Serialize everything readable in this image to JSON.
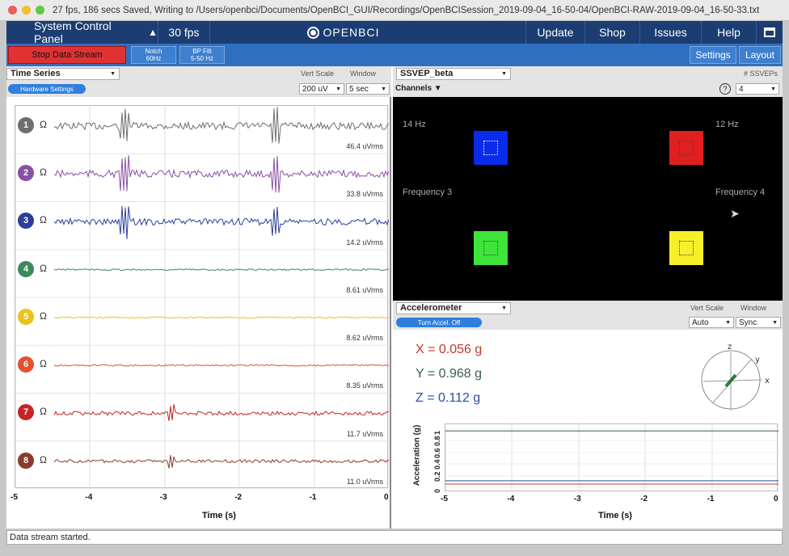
{
  "window": {
    "title": "27 fps, 186 secs Saved, Writing to /Users/openbci/Documents/OpenBCI_GUI/Recordings/OpenBCISession_2019-09-04_16-50-04/OpenBCI-RAW-2019-09-04_16-50-33.txt"
  },
  "nav": {
    "system_control_panel": "System Control Panel",
    "caret": "▲",
    "fps": "30 fps",
    "logo": "OPENBCI",
    "update": "Update",
    "shop": "Shop",
    "issues": "Issues",
    "help": "Help"
  },
  "controls": {
    "stop_stream": "Stop Data Stream",
    "notch_line1": "Notch",
    "notch_line2": "60Hz",
    "bp_line1": "BP Filt",
    "bp_line2": "5-50 Hz",
    "settings": "Settings",
    "layout": "Layout"
  },
  "time_series": {
    "widget": "Time Series",
    "hardware_settings": "Hardware Settings",
    "vert_scale_label": "Vert Scale",
    "window_label": "Window",
    "vert_scale_value": "200 uV",
    "window_value": "5 sec",
    "channels": [
      {
        "num": "1",
        "color": "#6e6e6e",
        "rms": "46.4 uVrms"
      },
      {
        "num": "2",
        "color": "#8a4fa3",
        "rms": "33.8 uVrms"
      },
      {
        "num": "3",
        "color": "#2d3e9c",
        "rms": "14.2 uVrms"
      },
      {
        "num": "4",
        "color": "#3a8a5c",
        "rms": "8.61 uVrms"
      },
      {
        "num": "5",
        "color": "#e8c31c",
        "rms": "8.62 uVrms"
      },
      {
        "num": "6",
        "color": "#e4512f",
        "rms": "8.35 uVrms"
      },
      {
        "num": "7",
        "color": "#c42424",
        "rms": "11.7 uVrms"
      },
      {
        "num": "8",
        "color": "#8a3a2e",
        "rms": "11.0 uVrms"
      }
    ],
    "x_ticks": [
      "-5",
      "-4",
      "-3",
      "-2",
      "-1",
      "0"
    ],
    "x_label": "Time (s)"
  },
  "ssvep": {
    "widget": "SSVEP_beta",
    "num_label": "# SSVEPs",
    "help": "?",
    "num_value": "4",
    "channels": "Channels ▼",
    "labels": [
      "14 Hz",
      "12 Hz",
      "Frequency 3",
      "Frequency 4"
    ],
    "colors": [
      "#0a2bea",
      "#e01f1f",
      "#3ee43a",
      "#f7ef2a"
    ]
  },
  "accel": {
    "widget": "Accelerometer",
    "turn_off": "Turn Accel. Off",
    "vert_scale_label": "Vert Scale",
    "window_label": "Window",
    "vert_scale_value": "Auto",
    "window_value": "Sync",
    "x_value": "X = 0.056 g",
    "y_value": "Y = 0.968 g",
    "z_value": "Z = 0.112 g",
    "x_color": "#c0392b",
    "y_color": "#3a5f4a",
    "z_color": "#2d4ea3",
    "axes": [
      "z",
      "y",
      "x"
    ],
    "y_label": "Acceleration (g)",
    "y_ticks": [
      "0",
      "0.2",
      "0.4",
      "0.6",
      "0.8",
      "1"
    ],
    "x_ticks": [
      "-5",
      "-4",
      "-3",
      "-2",
      "-1",
      "0"
    ],
    "x_label": "Time (s)"
  },
  "status": {
    "text": "Data stream started."
  }
}
